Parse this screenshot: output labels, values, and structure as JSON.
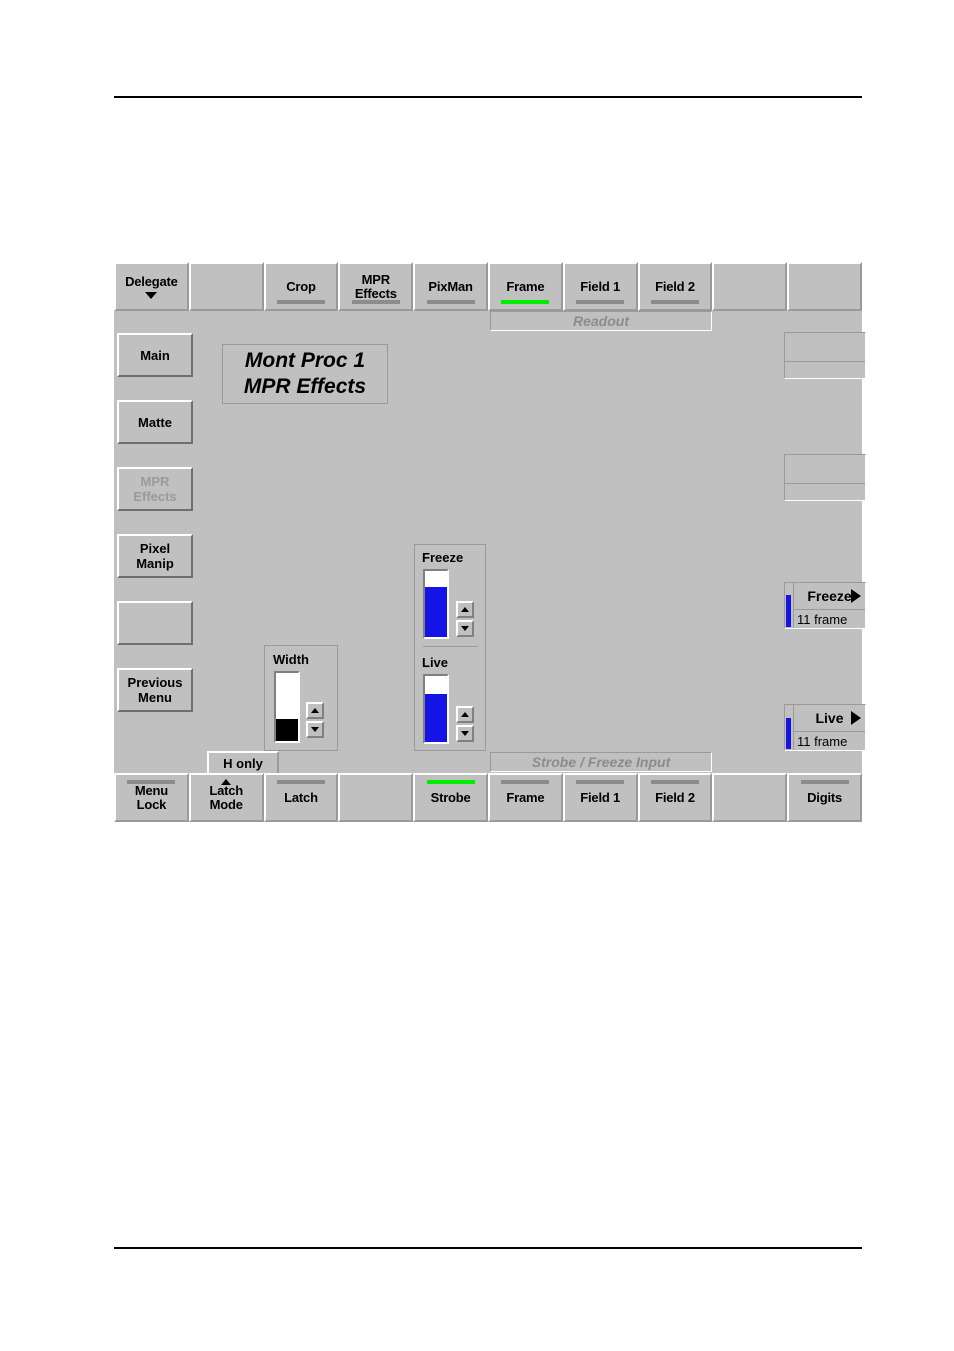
{
  "panel": {
    "title_line1": "Mont Proc 1",
    "title_line2": "MPR Effects",
    "readout_top_label": "Readout",
    "readout_bottom_label": "Strobe / Freeze Input",
    "h_only_tab": "H only"
  },
  "top_row": [
    {
      "label": "Delegate",
      "indicator": "none",
      "caret": "down",
      "blank": false
    },
    {
      "label": "",
      "indicator": "none",
      "caret": "none",
      "blank": true
    },
    {
      "label": "Crop",
      "indicator": "grey",
      "caret": "none",
      "blank": false
    },
    {
      "label": "MPR\nEffects",
      "indicator": "grey",
      "caret": "none",
      "blank": false
    },
    {
      "label": "PixMan",
      "indicator": "grey",
      "caret": "none",
      "blank": false
    },
    {
      "label": "Frame",
      "indicator": "green",
      "caret": "none",
      "blank": false
    },
    {
      "label": "Field 1",
      "indicator": "grey",
      "caret": "none",
      "blank": false
    },
    {
      "label": "Field 2",
      "indicator": "grey",
      "caret": "none",
      "blank": false
    },
    {
      "label": "",
      "indicator": "none",
      "caret": "none",
      "blank": true
    },
    {
      "label": "",
      "indicator": "none",
      "caret": "none",
      "blank": true
    }
  ],
  "bottom_row": [
    {
      "label": "Menu\nLock",
      "indicator": "grey",
      "caret": "none",
      "blank": false
    },
    {
      "label": "Latch\nMode",
      "indicator": "none",
      "caret": "up",
      "blank": false
    },
    {
      "label": "Latch",
      "indicator": "grey",
      "caret": "none",
      "blank": false
    },
    {
      "label": "",
      "indicator": "none",
      "caret": "none",
      "blank": true
    },
    {
      "label": "Strobe",
      "indicator": "green",
      "caret": "none",
      "blank": false
    },
    {
      "label": "Frame",
      "indicator": "grey",
      "caret": "none",
      "blank": false
    },
    {
      "label": "Field 1",
      "indicator": "grey",
      "caret": "none",
      "blank": false
    },
    {
      "label": "Field 2",
      "indicator": "grey",
      "caret": "none",
      "blank": false
    },
    {
      "label": "",
      "indicator": "none",
      "caret": "none",
      "blank": true
    },
    {
      "label": "Digits",
      "indicator": "grey",
      "caret": "none",
      "blank": false
    }
  ],
  "menu_column": [
    {
      "label": "Main",
      "state": "normal"
    },
    {
      "label": "Matte",
      "state": "normal"
    },
    {
      "label": "MPR\nEffects",
      "state": "disabled"
    },
    {
      "label": "Pixel\nManip",
      "state": "normal"
    },
    {
      "label": "",
      "state": "empty"
    },
    {
      "label": "Previous\nMenu",
      "state": "normal"
    }
  ],
  "sliders": {
    "width": {
      "label": "Width",
      "fill_percent": 33,
      "fill_color": "#000000"
    },
    "freeze": {
      "label": "Freeze",
      "fill_percent": 76,
      "fill_color": "#1414e6"
    },
    "live": {
      "label": "Live",
      "fill_percent": 73,
      "fill_color": "#1414e6"
    }
  },
  "right_readouts": [
    {
      "kind": "empty",
      "name": "",
      "value": ""
    },
    {
      "kind": "empty",
      "name": "",
      "value": ""
    },
    {
      "kind": "value",
      "name": "Freeze",
      "value": "11 frame",
      "bar_percent": 76,
      "bar_color": "#1414e6"
    },
    {
      "kind": "value",
      "name": "Live",
      "value": "11 frame",
      "bar_percent": 73,
      "bar_color": "#1414e6"
    }
  ]
}
